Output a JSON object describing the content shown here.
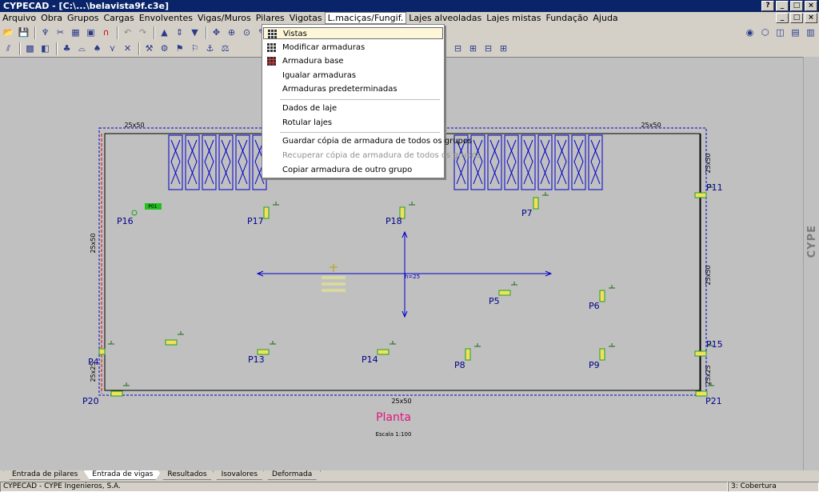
{
  "window": {
    "title": "CYPECAD - [C:\\...\\belavista9f.c3e]"
  },
  "title_buttons": [
    "?",
    "_",
    "□",
    "×"
  ],
  "mdi_buttons": [
    "_",
    "□",
    "×"
  ],
  "menubar": [
    "Arquivo",
    "Obra",
    "Grupos",
    "Cargas",
    "Envolventes",
    "Vigas/Muros",
    "Pilares",
    "Vigotas",
    "L.maciças/Fungif.",
    "Lajes alveoladas",
    "Lajes mistas",
    "Fundação",
    "Ajuda"
  ],
  "dropdown": {
    "items": [
      {
        "label": "Vistas",
        "icon": "grid-icon",
        "highlight": true
      },
      {
        "label": "Modificar armaduras",
        "icon": "grid-icon"
      },
      {
        "label": "Armadura base",
        "icon": "grid-red-icon"
      },
      {
        "label": "Igualar armaduras"
      },
      {
        "label": "Armaduras predeterminadas"
      },
      {
        "label": "Dados de laje"
      },
      {
        "label": "Rotular lajes"
      },
      {
        "label": "Guardar cópia de armadura de todos os grupos"
      },
      {
        "label": "Recuperar cópia de armadura de todos os grupos",
        "disabled": true
      },
      {
        "label": "Copiar armadura de outro grupo"
      }
    ]
  },
  "drawing": {
    "title": "Planta",
    "scale": "Escala 1:100",
    "beam_label": "25x50",
    "beam_label_small": "25x25",
    "slab_thickness": "h=25",
    "pillar_tag": "P01",
    "pillars": [
      "P16",
      "P17",
      "P18",
      "P7",
      "P11",
      "P5",
      "P6",
      "P13",
      "P14",
      "P8",
      "P9",
      "P15",
      "P4",
      "P20",
      "P21"
    ]
  },
  "tabs": [
    "Entrada de pilares",
    "Entrada de vigas",
    "Resultados",
    "Isovalores",
    "Deformada"
  ],
  "status": {
    "left": "CYPECAD - CYPE Ingenieros, S.A.",
    "right": "3: Cobertura"
  },
  "logo": "CYPE",
  "colors": {
    "title_bg": "#0a246a",
    "canvas": "#c0c0c0",
    "structure": "#0000cc",
    "title_text": "#e0157a"
  }
}
